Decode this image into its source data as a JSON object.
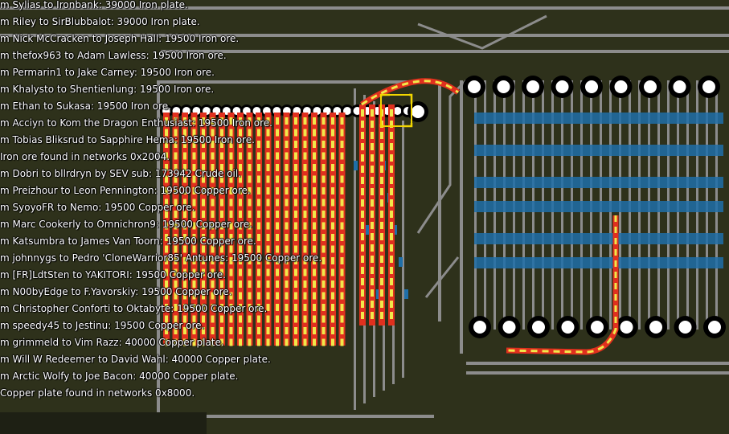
{
  "colors": {
    "ground": "#2e311b",
    "ground_dark": "#1e2014",
    "belt_gray": "#8c8c8c",
    "water_blue": "#1f6fa8",
    "train_red": "#e0301e",
    "train_yellow": "#f2e84a",
    "node_white": "#ffffff",
    "selection_yellow": "#f2d600"
  },
  "icons": {
    "train-stop": "white-circle-black-ring",
    "wagon": "yellow-arrow",
    "selection": "yellow-bracket"
  },
  "log": {
    "lines": [
      "m Sylias to Ironbank: 39000  Iron plate.",
      "m Riley to SirBlubbalot: 39000  Iron plate.",
      "m Nick McCracken to Joseph Hall: 19500  Iron ore.",
      "m thefox963 to Adam Lawless: 19500  Iron ore.",
      "m Permarin1 to Jake Carney: 19500  Iron ore.",
      "m Khalysto to Shentienlung: 19500  Iron ore.",
      "m Ethan to Sukasa: 19500  Iron ore.",
      "m Acciyn to Kom the Dragon Enthusiast: 19500  Iron ore.",
      "m Tobias Bliksrud to Sapphire Hema: 19500  Iron ore.",
      " Iron ore found in networks 0x2004.",
      "m Dobri to bllrdryn by SEV sub: 173942  Crude oil.",
      "m Preizhour to Leon Pennington: 19500  Copper ore.",
      "m SyoyoFR to Nemo: 19500  Copper ore.",
      "m Marc Cookerly to Omnichron9: 19500  Copper ore.",
      "m Katsumbra to James Van Toorn: 19500  Copper ore.",
      "m johnnygs to Pedro 'CloneWarrior85' Antunes: 19500  Copper ore.",
      "m [FR]LdtSten to YAKITORI: 19500  Copper ore.",
      "m N00byEdge to F.Yavorskiy: 19500  Copper ore.",
      "m Christopher Conforti to Oktabyte: 19500  Copper ore.",
      "m speedy45 to Jestinu: 19500  Copper ore.",
      "m grimmeld to Vim Razz: 40000  Copper plate.",
      "m Will W Redeemer to David Wahl: 40000  Copper plate.",
      "m Arctic Wolfy to Joe Bacon: 40000  Copper plate.",
      " Copper plate found in networks 0x8000."
    ]
  }
}
